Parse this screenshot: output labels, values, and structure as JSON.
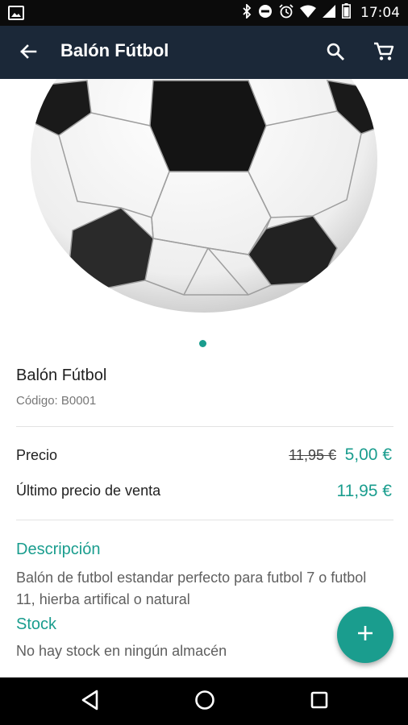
{
  "status_bar": {
    "time": "17:04",
    "icons": [
      "image-icon",
      "bluetooth-icon",
      "do-not-disturb-icon",
      "alarm-icon",
      "wifi-icon",
      "signal-icon",
      "battery-icon"
    ]
  },
  "app_bar": {
    "title": "Balón Fútbol",
    "icons": [
      "back-arrow-icon",
      "search-icon",
      "cart-icon"
    ],
    "background": "#1b2838"
  },
  "product": {
    "name": "Balón Fútbol",
    "code": "Código: B0001",
    "image": "soccer-ball-photo"
  },
  "pricing": {
    "price_label": "Precio",
    "old_price": "11,95 €",
    "new_price": "5,00 €",
    "last_sale_label": "Último precio de venta",
    "last_sale_price": "11,95 €"
  },
  "description": {
    "title": "Descripción",
    "text": "Balón de futbol estandar perfecto para futbol 7 o futbol 11, hierba artifical o natural"
  },
  "stock": {
    "title": "Stock",
    "text": "No hay stock en ningún almacén"
  },
  "fab": {
    "icon": "plus-icon"
  },
  "nav_bar": {
    "icons": [
      "nav-back-icon",
      "nav-home-icon",
      "nav-recents-icon"
    ]
  },
  "colors": {
    "accent": "#1a9d8e",
    "toolbar": "#1b2838",
    "status_bar": "#0b0b0b"
  }
}
